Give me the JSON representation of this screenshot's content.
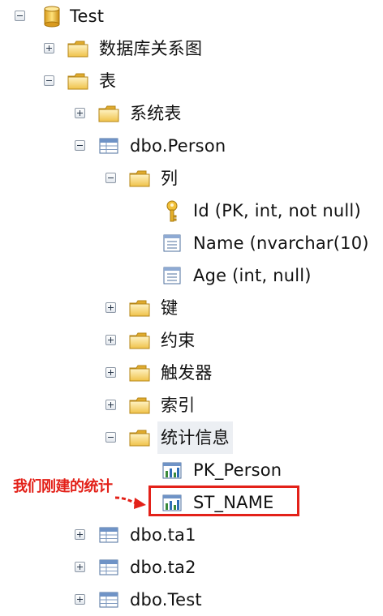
{
  "tree": {
    "database": "Test",
    "db_diagrams": "数据库关系图",
    "tables": "表",
    "system_tables": "系统表",
    "person_table": "dbo.Person",
    "columns": "列",
    "col_id": "Id (PK, int, not null)",
    "col_name": "Name (nvarchar(10)",
    "col_age": "Age (int, null)",
    "keys": "键",
    "constraints": "约束",
    "triggers": "触发器",
    "indexes": "索引",
    "statistics": "统计信息",
    "stat_pk": "PK_Person",
    "stat_st": "ST_NAME",
    "table_ta1": "dbo.ta1",
    "table_ta2": "dbo.ta2",
    "table_test": "dbo.Test"
  },
  "annotation": "我们刚建的统计",
  "colors": {
    "annotation": "#e32119",
    "folder": "#f2c94c",
    "selection": "#eceff3"
  },
  "icons": [
    "database-icon",
    "folder-icon",
    "table-icon",
    "key-icon",
    "column-icon",
    "statistics-icon"
  ]
}
